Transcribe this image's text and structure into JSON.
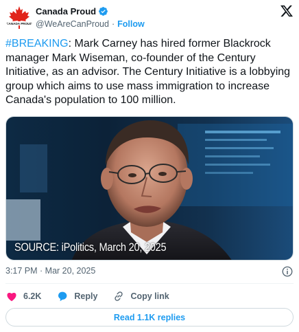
{
  "author": {
    "display_name": "Canada Proud",
    "handle": "@WeAreCanProud",
    "separator": "·",
    "follow_label": "Follow",
    "avatar_text": "CANADA PROUD",
    "verified": true
  },
  "tweet": {
    "hashtag": "#BREAKING",
    "body": ": Mark Carney has hired former Blackrock manager Mark Wiseman, co-founder of the Century Initiative, as an advisor. The Century Initiative is a lobbying group which aims to use mass immigration to increase Canada's population to 100 million."
  },
  "media": {
    "caption": "SOURCE: iPolitics, March 20, 2025"
  },
  "meta": {
    "timestamp": "3:17 PM · Mar 20, 2025"
  },
  "actions": {
    "likes": "6.2K",
    "reply_label": "Reply",
    "copy_link_label": "Copy link"
  },
  "replies_button": "Read 1.1K replies",
  "colors": {
    "accent": "#1d9bf0",
    "like": "#f91880",
    "text": "#0f1419",
    "muted": "#536471"
  },
  "icons": [
    "maple-leaf-icon",
    "verified-badge-icon",
    "x-logo-icon",
    "info-icon",
    "heart-icon",
    "reply-bubble-icon",
    "link-icon"
  ]
}
